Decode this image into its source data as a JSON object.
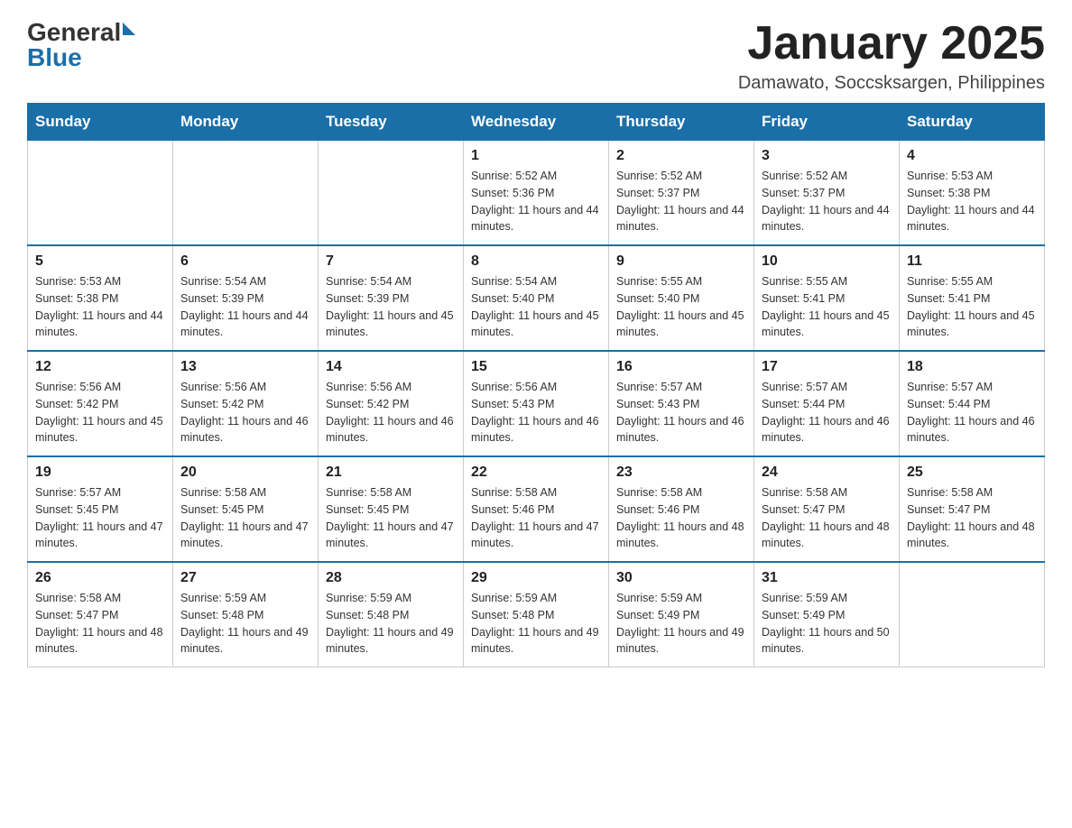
{
  "header": {
    "logo": {
      "general": "General",
      "arrow": "▶",
      "blue": "Blue"
    },
    "title": "January 2025",
    "subtitle": "Damawato, Soccsksargen, Philippines"
  },
  "calendar": {
    "days_of_week": [
      "Sunday",
      "Monday",
      "Tuesday",
      "Wednesday",
      "Thursday",
      "Friday",
      "Saturday"
    ],
    "weeks": [
      [
        {
          "day": "",
          "info": ""
        },
        {
          "day": "",
          "info": ""
        },
        {
          "day": "",
          "info": ""
        },
        {
          "day": "1",
          "info": "Sunrise: 5:52 AM\nSunset: 5:36 PM\nDaylight: 11 hours and 44 minutes."
        },
        {
          "day": "2",
          "info": "Sunrise: 5:52 AM\nSunset: 5:37 PM\nDaylight: 11 hours and 44 minutes."
        },
        {
          "day": "3",
          "info": "Sunrise: 5:52 AM\nSunset: 5:37 PM\nDaylight: 11 hours and 44 minutes."
        },
        {
          "day": "4",
          "info": "Sunrise: 5:53 AM\nSunset: 5:38 PM\nDaylight: 11 hours and 44 minutes."
        }
      ],
      [
        {
          "day": "5",
          "info": "Sunrise: 5:53 AM\nSunset: 5:38 PM\nDaylight: 11 hours and 44 minutes."
        },
        {
          "day": "6",
          "info": "Sunrise: 5:54 AM\nSunset: 5:39 PM\nDaylight: 11 hours and 44 minutes."
        },
        {
          "day": "7",
          "info": "Sunrise: 5:54 AM\nSunset: 5:39 PM\nDaylight: 11 hours and 45 minutes."
        },
        {
          "day": "8",
          "info": "Sunrise: 5:54 AM\nSunset: 5:40 PM\nDaylight: 11 hours and 45 minutes."
        },
        {
          "day": "9",
          "info": "Sunrise: 5:55 AM\nSunset: 5:40 PM\nDaylight: 11 hours and 45 minutes."
        },
        {
          "day": "10",
          "info": "Sunrise: 5:55 AM\nSunset: 5:41 PM\nDaylight: 11 hours and 45 minutes."
        },
        {
          "day": "11",
          "info": "Sunrise: 5:55 AM\nSunset: 5:41 PM\nDaylight: 11 hours and 45 minutes."
        }
      ],
      [
        {
          "day": "12",
          "info": "Sunrise: 5:56 AM\nSunset: 5:42 PM\nDaylight: 11 hours and 45 minutes."
        },
        {
          "day": "13",
          "info": "Sunrise: 5:56 AM\nSunset: 5:42 PM\nDaylight: 11 hours and 46 minutes."
        },
        {
          "day": "14",
          "info": "Sunrise: 5:56 AM\nSunset: 5:42 PM\nDaylight: 11 hours and 46 minutes."
        },
        {
          "day": "15",
          "info": "Sunrise: 5:56 AM\nSunset: 5:43 PM\nDaylight: 11 hours and 46 minutes."
        },
        {
          "day": "16",
          "info": "Sunrise: 5:57 AM\nSunset: 5:43 PM\nDaylight: 11 hours and 46 minutes."
        },
        {
          "day": "17",
          "info": "Sunrise: 5:57 AM\nSunset: 5:44 PM\nDaylight: 11 hours and 46 minutes."
        },
        {
          "day": "18",
          "info": "Sunrise: 5:57 AM\nSunset: 5:44 PM\nDaylight: 11 hours and 46 minutes."
        }
      ],
      [
        {
          "day": "19",
          "info": "Sunrise: 5:57 AM\nSunset: 5:45 PM\nDaylight: 11 hours and 47 minutes."
        },
        {
          "day": "20",
          "info": "Sunrise: 5:58 AM\nSunset: 5:45 PM\nDaylight: 11 hours and 47 minutes."
        },
        {
          "day": "21",
          "info": "Sunrise: 5:58 AM\nSunset: 5:45 PM\nDaylight: 11 hours and 47 minutes."
        },
        {
          "day": "22",
          "info": "Sunrise: 5:58 AM\nSunset: 5:46 PM\nDaylight: 11 hours and 47 minutes."
        },
        {
          "day": "23",
          "info": "Sunrise: 5:58 AM\nSunset: 5:46 PM\nDaylight: 11 hours and 48 minutes."
        },
        {
          "day": "24",
          "info": "Sunrise: 5:58 AM\nSunset: 5:47 PM\nDaylight: 11 hours and 48 minutes."
        },
        {
          "day": "25",
          "info": "Sunrise: 5:58 AM\nSunset: 5:47 PM\nDaylight: 11 hours and 48 minutes."
        }
      ],
      [
        {
          "day": "26",
          "info": "Sunrise: 5:58 AM\nSunset: 5:47 PM\nDaylight: 11 hours and 48 minutes."
        },
        {
          "day": "27",
          "info": "Sunrise: 5:59 AM\nSunset: 5:48 PM\nDaylight: 11 hours and 49 minutes."
        },
        {
          "day": "28",
          "info": "Sunrise: 5:59 AM\nSunset: 5:48 PM\nDaylight: 11 hours and 49 minutes."
        },
        {
          "day": "29",
          "info": "Sunrise: 5:59 AM\nSunset: 5:48 PM\nDaylight: 11 hours and 49 minutes."
        },
        {
          "day": "30",
          "info": "Sunrise: 5:59 AM\nSunset: 5:49 PM\nDaylight: 11 hours and 49 minutes."
        },
        {
          "day": "31",
          "info": "Sunrise: 5:59 AM\nSunset: 5:49 PM\nDaylight: 11 hours and 50 minutes."
        },
        {
          "day": "",
          "info": ""
        }
      ]
    ]
  }
}
